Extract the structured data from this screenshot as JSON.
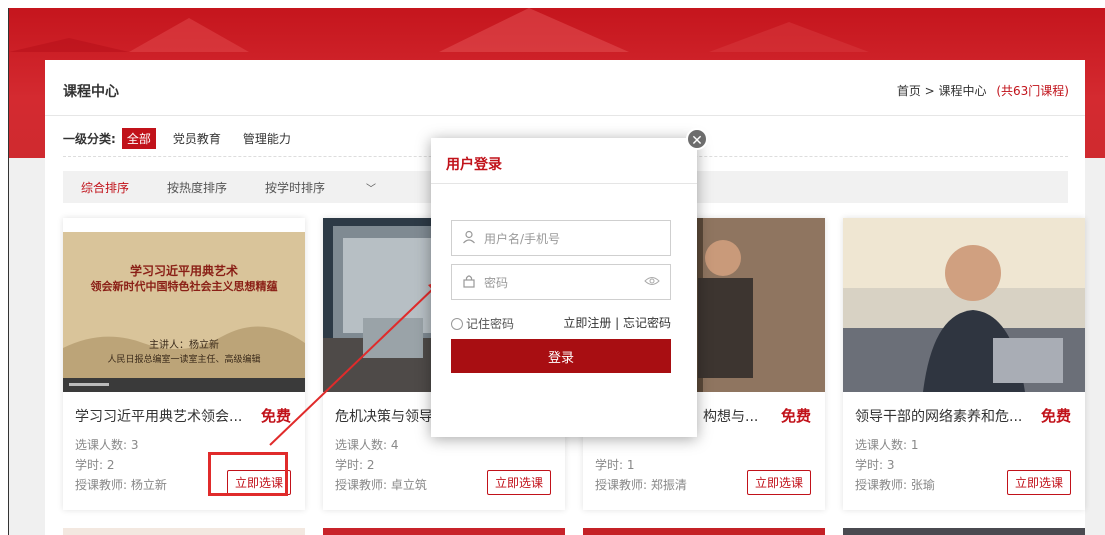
{
  "header": {
    "title": "课程中心",
    "breadcrumb": "首页 > 课程中心",
    "count": "(共63门课程)"
  },
  "categories": {
    "label": "一级分类:",
    "items": [
      "全部",
      "党员教育",
      "管理能力"
    ]
  },
  "sort": {
    "items": [
      "综合排序",
      "按热度排序",
      "按学时排序"
    ]
  },
  "courses": [
    {
      "title": "学习习近平用典艺术领会...",
      "price": "免费",
      "enrolled": "选课人数: 3",
      "hours": "学时: 2",
      "teacher": "授课教师: 杨立新",
      "button": "立即选课",
      "thumb_text": {
        "line1": "学习习近平用典艺术",
        "line2": "领会新时代中国特色社会主义思想精蕴",
        "line3": "主讲人：杨立新",
        "line4": "人民日报总编室一读室主任、高级编辑"
      }
    },
    {
      "title": "危机决策与领导力",
      "price": "",
      "enrolled": "选课人数: 4",
      "hours": "学时: 2",
      "teacher": "授课教师: 卓立筑",
      "button": "立即选课"
    },
    {
      "title": "构想与...",
      "price": "免费",
      "enrolled": "",
      "hours": "学时: 1",
      "teacher": "授课教师: 郑振清",
      "button": "立即选课"
    },
    {
      "title": "领导干部的网络素养和危...",
      "price": "免费",
      "enrolled": "选课人数: 1",
      "hours": "学时: 3",
      "teacher": "授课教师: 张瑜",
      "button": "立即选课"
    }
  ],
  "login": {
    "title": "用户登录",
    "username_placeholder": "用户名/手机号",
    "password_placeholder": "密码",
    "remember": "记住密码",
    "links": "立即注册 | 忘记密码",
    "submit": "登录",
    "close": "✕"
  },
  "colors": {
    "accent": "#c1121a",
    "banner": "#c5151d",
    "button_dark": "#a80e12"
  }
}
